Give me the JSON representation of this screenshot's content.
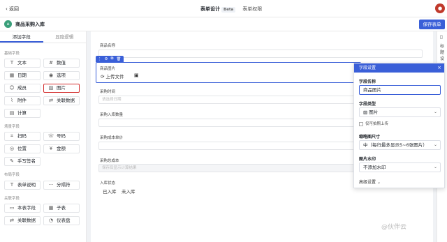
{
  "topbar": {
    "back": "返回",
    "tab_design": "表单设计",
    "beta": "Beta",
    "tab_perm": "表单权限"
  },
  "app": {
    "title": "商品采购入库",
    "save": "保存表单"
  },
  "left": {
    "tabs": [
      "添加字段",
      "显隐逻辑"
    ],
    "sections": {
      "basic": "基础字段",
      "scene": "场景字段",
      "layout": "布局字段",
      "related": "关联字段"
    },
    "basic_items": [
      "文本",
      "数值",
      "日期",
      "选项",
      "成员",
      "图片",
      "附件",
      "关联数据",
      "计算"
    ],
    "scene_items": [
      "扫码",
      "号码",
      "位置",
      "金额",
      "手写签名"
    ],
    "layout_items": [
      "表单说明",
      "分隔符"
    ],
    "related_items": [
      "本表字段",
      "子表",
      "关联数据",
      "仪表盘"
    ]
  },
  "form": {
    "f1_label": "商品名称",
    "f2_label": "商品图片",
    "upload": "上传文件",
    "f3_label": "采购时间",
    "f3_ph": "请选择日期",
    "f4_label": "采购入库数量",
    "f5_label": "采购成本单价",
    "f6_label": "采购总成本",
    "f6_ph": "保存后显示计算结果",
    "f7_label": "入库状态",
    "opt1": "已入库",
    "opt2": "未入库"
  },
  "rail": {
    "t1": "标",
    "t2": "题",
    "t3": "设"
  },
  "panel": {
    "title": "字段设置",
    "name_label": "字段名称",
    "name_value": "商品图片",
    "type_label": "字段类型",
    "type_value": "图片",
    "only_photo": "仅可拍照上传",
    "thumb_label": "缩略图尺寸",
    "thumb_value": "中（每行最多显示5~6张图片）",
    "wm_label": "图片水印",
    "wm_value": "不添加水印",
    "adv": "高级设置"
  },
  "watermark": "@伙伴云"
}
